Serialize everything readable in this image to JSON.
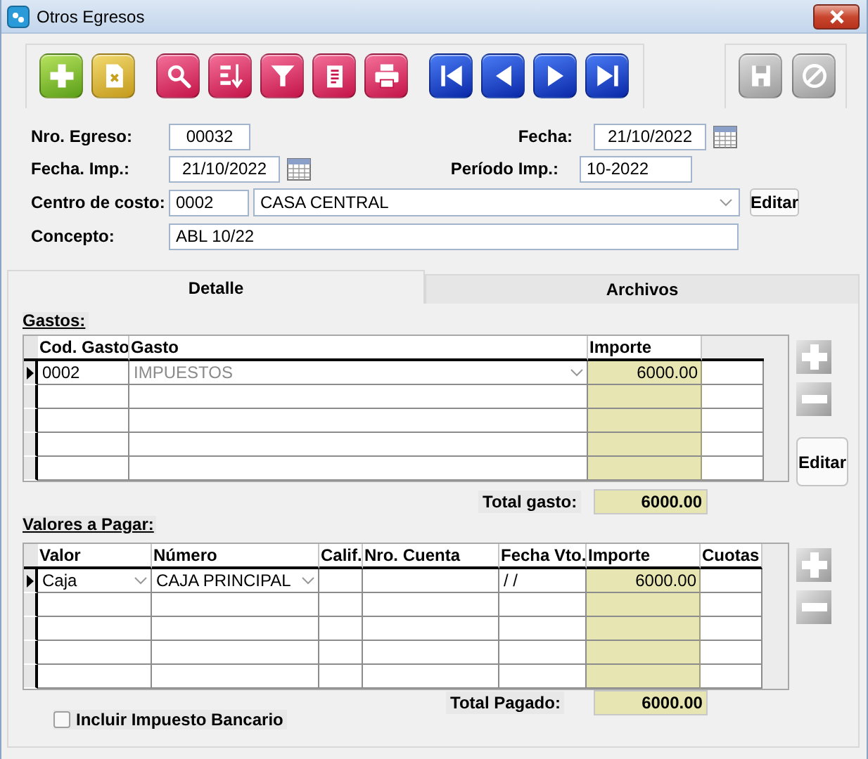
{
  "window": {
    "title": "Otros Egresos"
  },
  "toolbar": {
    "groups": [
      [
        {
          "kind": "add",
          "disabled": false
        },
        {
          "kind": "delete",
          "disabled": false
        }
      ],
      [
        {
          "kind": "search",
          "disabled": false
        },
        {
          "kind": "sort",
          "disabled": false
        },
        {
          "kind": "filter",
          "disabled": false
        },
        {
          "kind": "report",
          "disabled": false
        },
        {
          "kind": "print",
          "disabled": false
        }
      ],
      [
        {
          "kind": "first",
          "disabled": false
        },
        {
          "kind": "previous",
          "disabled": false
        },
        {
          "kind": "next",
          "disabled": false
        },
        {
          "kind": "last",
          "disabled": false
        }
      ]
    ],
    "actions": [
      {
        "kind": "save",
        "disabled": true
      },
      {
        "kind": "cancel",
        "disabled": true
      }
    ]
  },
  "header": {
    "nro_egreso": {
      "label": "Nro. Egreso:",
      "value": "00032"
    },
    "fecha": {
      "label": "Fecha:",
      "value": "21/10/2022",
      "kind": "date"
    },
    "fecha_imp": {
      "label": "Fecha. Imp.:",
      "value": "21/10/2022",
      "kind": "date"
    },
    "periodo_imp": {
      "label": "Período Imp.:",
      "value": "10-2022"
    },
    "centro_costo": {
      "label": "Centro de costo:",
      "code": "0002",
      "name": "CASA CENTRAL",
      "button": "Editar"
    },
    "concepto": {
      "label": "Concepto:",
      "value": "ABL 10/22"
    }
  },
  "tabs": [
    {
      "label": "Detalle",
      "selected": true
    },
    {
      "label": "Archivos",
      "selected": false
    }
  ],
  "gastos": {
    "title": "Gastos:",
    "columns": [
      {
        "label": "Cod. Gasto",
        "kind": "text",
        "disabled": false
      },
      {
        "label": "Gasto",
        "kind": "combo",
        "disabled": true
      },
      {
        "label": "Importe",
        "kind": "amount",
        "disabled": false
      }
    ],
    "rows": [
      {
        "selected": true,
        "cells": [
          "0002",
          "IMPUESTOS",
          "6000.00"
        ]
      }
    ],
    "side_buttons": [
      {
        "kind": "add"
      },
      {
        "kind": "remove"
      },
      {
        "kind": "edit",
        "label": "Editar"
      }
    ],
    "total_label": "Total gasto:",
    "total": "6000.00"
  },
  "valores": {
    "title": "Valores a Pagar:",
    "columns": [
      {
        "label": "Valor",
        "kind": "combo"
      },
      {
        "label": "Número",
        "kind": "combo"
      },
      {
        "label": "Calif.",
        "kind": "text"
      },
      {
        "label": "Nro. Cuenta",
        "kind": "text"
      },
      {
        "label": "Fecha Vto.",
        "kind": "text"
      },
      {
        "label": "Importe",
        "kind": "amount"
      },
      {
        "label": "Cuotas",
        "kind": "text"
      }
    ],
    "rows": [
      {
        "selected": true,
        "cells": [
          "Caja",
          "CAJA PRINCIPAL",
          null,
          null,
          "/ /",
          "6000.00",
          null
        ]
      }
    ],
    "side_buttons": [
      {
        "kind": "add"
      },
      {
        "kind": "remove"
      }
    ],
    "total_label": "Total Pagado:",
    "total": "6000.00"
  },
  "checkbox": {
    "label": "Incluir Impuesto Bancario",
    "checked": false
  }
}
